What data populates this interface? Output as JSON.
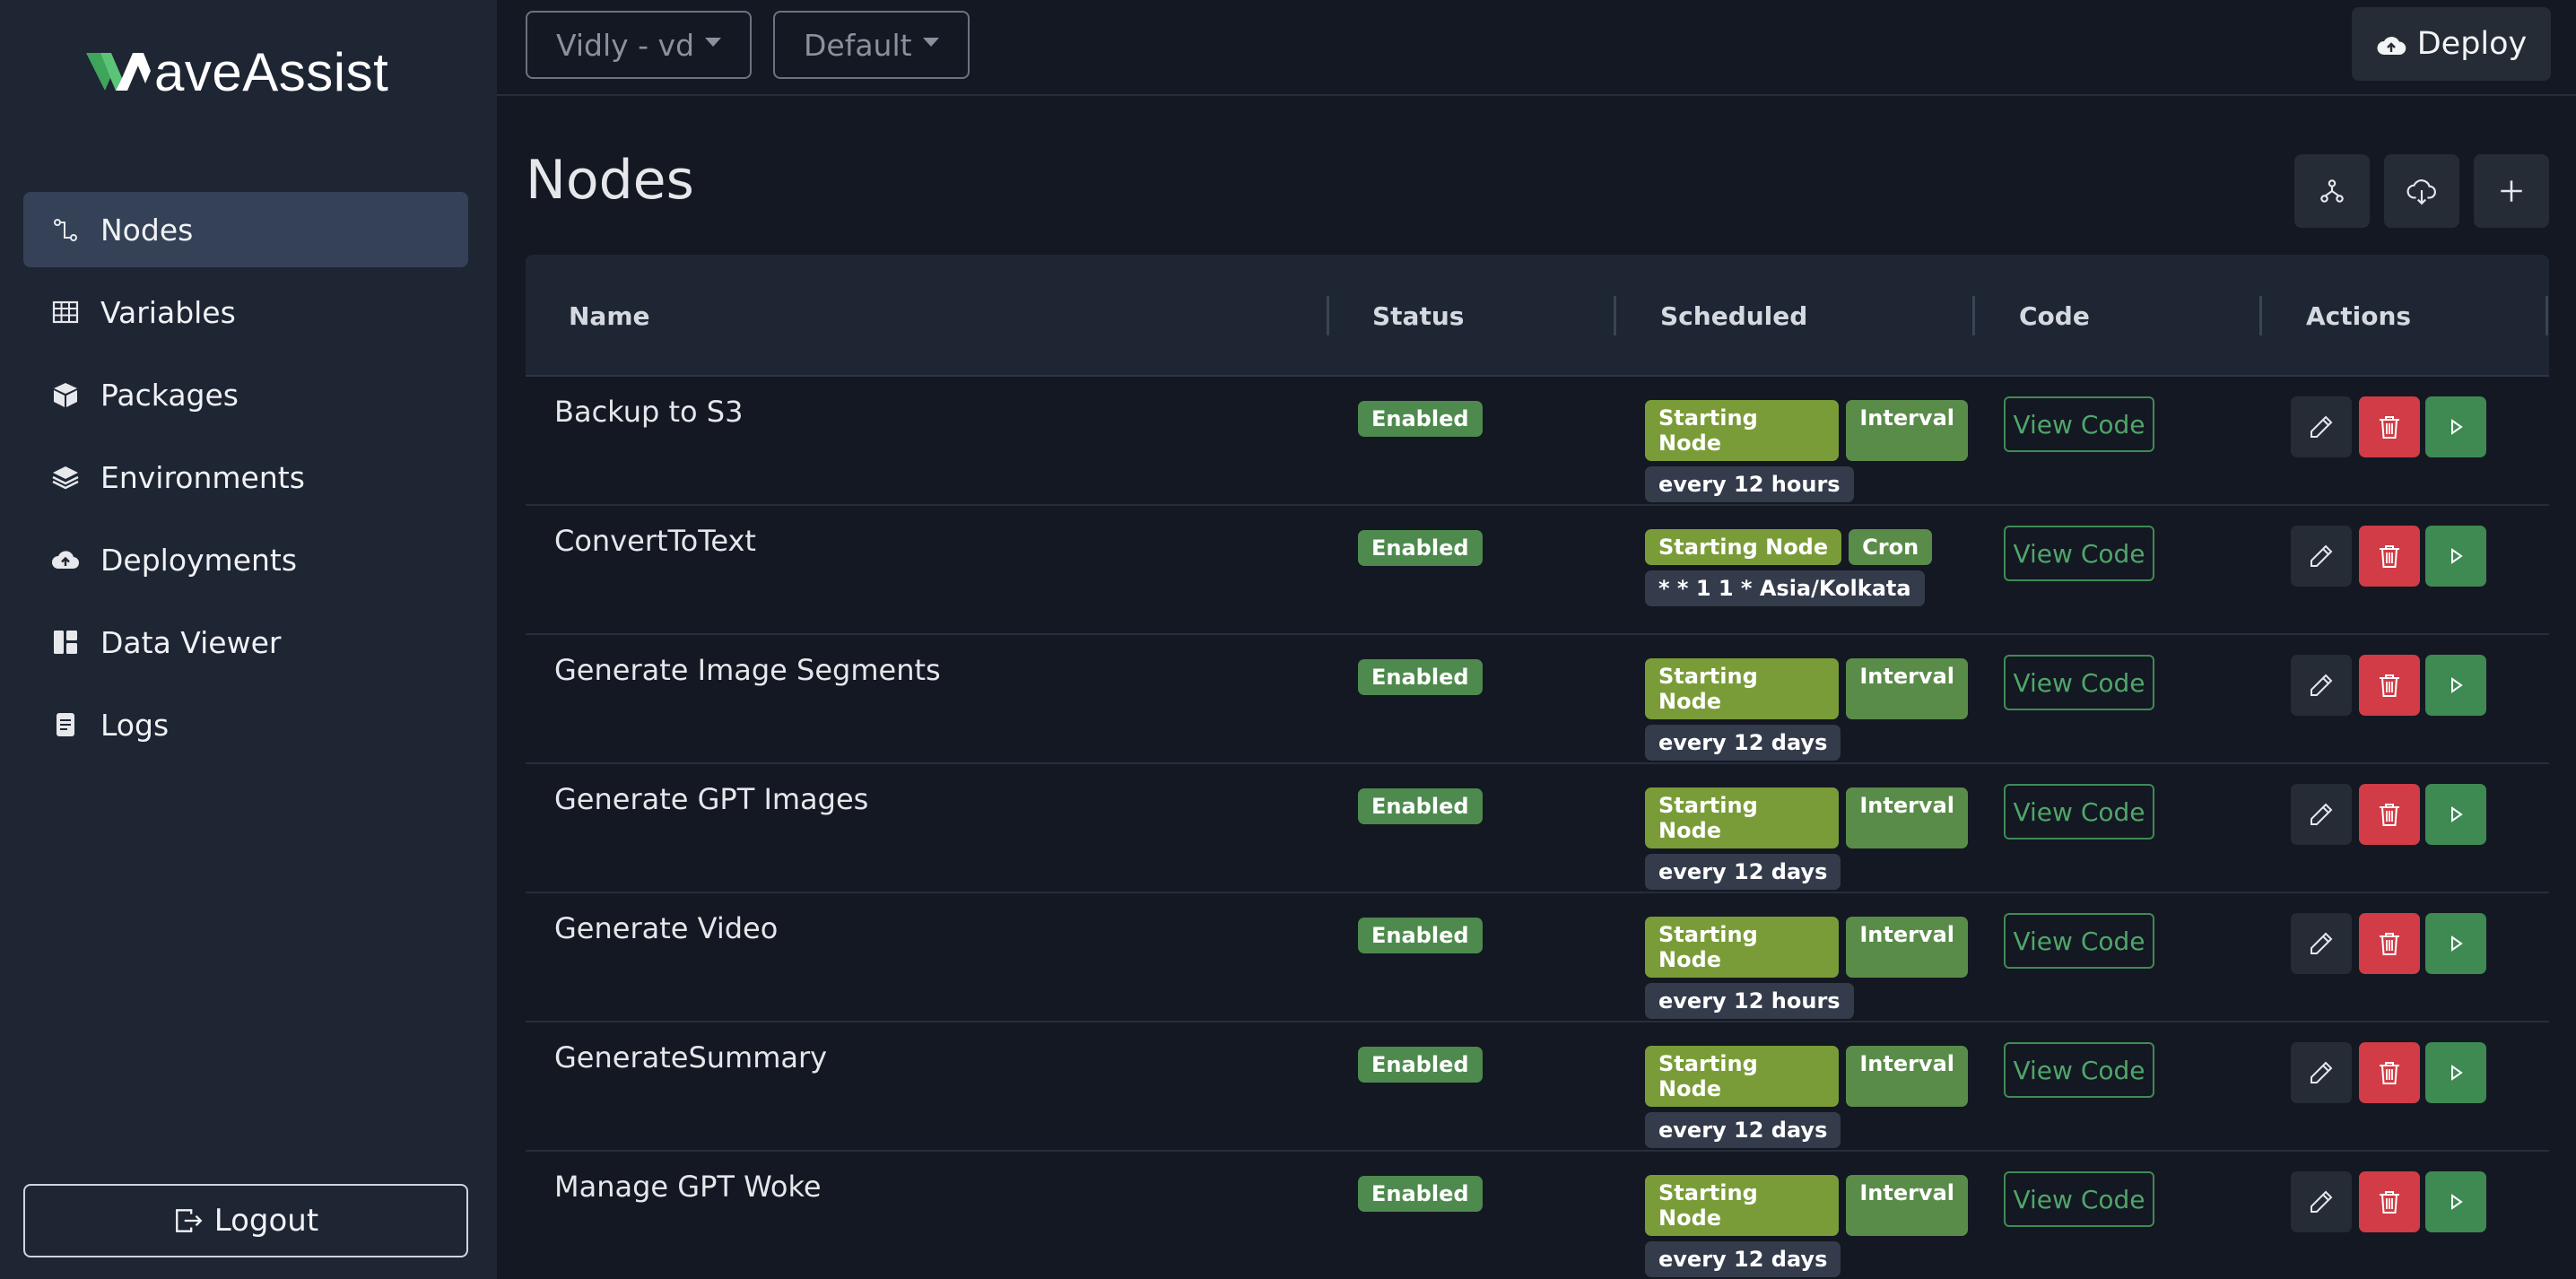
{
  "app": {
    "logo_text": "aveAssist",
    "brand_color": "#3fa55b"
  },
  "sidebar": {
    "items": [
      {
        "label": "Nodes",
        "icon": "nodes-icon",
        "active": true
      },
      {
        "label": "Variables",
        "icon": "table-icon",
        "active": false
      },
      {
        "label": "Packages",
        "icon": "box-icon",
        "active": false
      },
      {
        "label": "Environments",
        "icon": "layers-icon",
        "active": false
      },
      {
        "label": "Deployments",
        "icon": "cloud-upload-icon",
        "active": false
      },
      {
        "label": "Data Viewer",
        "icon": "dashboard-icon",
        "active": false
      },
      {
        "label": "Logs",
        "icon": "document-icon",
        "active": false
      }
    ],
    "logout_label": "Logout"
  },
  "topbar": {
    "project_select": "Vidly - vd",
    "env_select": "Default",
    "deploy_label": "Deploy"
  },
  "page": {
    "title": "Nodes"
  },
  "table": {
    "columns": [
      "Name",
      "Status",
      "Scheduled",
      "Code",
      "Actions"
    ],
    "view_code_label": "View Code",
    "rows": [
      {
        "name": "Backup to S3",
        "status": "Enabled",
        "start": "Starting Node",
        "type": "Interval",
        "detail": "every 12 hours"
      },
      {
        "name": "ConvertToText",
        "status": "Enabled",
        "start": "Starting Node",
        "type": "Cron",
        "detail": "* * 1 1 * Asia/Kolkata"
      },
      {
        "name": "Generate Image Segments",
        "status": "Enabled",
        "start": "Starting Node",
        "type": "Interval",
        "detail": "every 12 days"
      },
      {
        "name": "Generate GPT Images",
        "status": "Enabled",
        "start": "Starting Node",
        "type": "Interval",
        "detail": "every 12 days"
      },
      {
        "name": "Generate Video",
        "status": "Enabled",
        "start": "Starting Node",
        "type": "Interval",
        "detail": "every 12 hours"
      },
      {
        "name": "GenerateSummary",
        "status": "Enabled",
        "start": "Starting Node",
        "type": "Interval",
        "detail": "every 12 days"
      },
      {
        "name": "Manage GPT Woke",
        "status": "Enabled",
        "start": "Starting Node",
        "type": "Interval",
        "detail": "every 12 days"
      }
    ]
  }
}
